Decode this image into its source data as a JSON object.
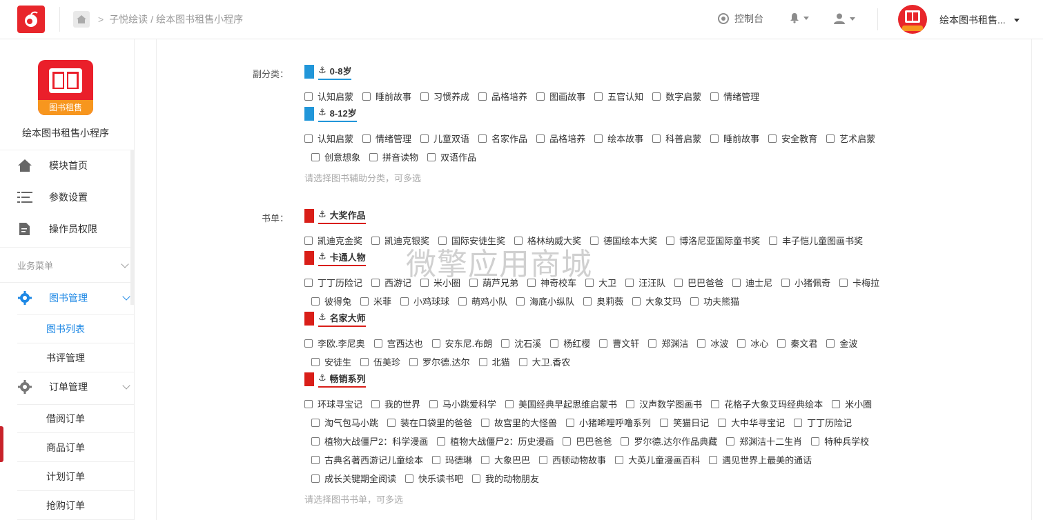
{
  "header": {
    "breadcrumb": [
      "子悦绘读",
      "绘本图书租售小程序"
    ],
    "breadcrumb_sep": ">",
    "console_label": "控制台",
    "store_name": "绘本图书租售...",
    "avatar_badge": "图书租售"
  },
  "sidebar": {
    "app_name": "绘本图书租售小程序",
    "logo_ribbon": "图书租售",
    "top_items": [
      {
        "label": "模块首页",
        "icon": "home-icon"
      },
      {
        "label": "参数设置",
        "icon": "list-settings-icon"
      },
      {
        "label": "操作员权限",
        "icon": "doc-edit-icon"
      }
    ],
    "group_title": "业务菜单",
    "book_mgmt": "图书管理",
    "book_sub": [
      "图书列表",
      "书评管理"
    ],
    "order_mgmt": "订单管理",
    "order_sub": [
      "借阅订单",
      "商品订单",
      "计划订单",
      "抢购订单"
    ]
  },
  "form": {
    "subcategory_label": "副分类：",
    "booklist_label": "书单：",
    "subcategory_hint": "请选择图书辅助分类，可多选",
    "booklist_hint": "请选择图书书单，可多选",
    "groups": {
      "age_0_8": {
        "title": "0-8岁",
        "options": [
          "认知启蒙",
          "睡前故事",
          "习惯养成",
          "品格培养",
          "图画故事",
          "五官认知",
          "数字启蒙",
          "情绪管理"
        ]
      },
      "age_8_12": {
        "title": "8-12岁",
        "options": [
          "认知启蒙",
          "情绪管理",
          "儿童双语",
          "名家作品",
          "品格培养",
          "绘本故事",
          "科普启蒙",
          "睡前故事",
          "安全教育",
          "艺术启蒙",
          "创意想象",
          "拼音读物",
          "双语作品"
        ]
      },
      "awards": {
        "title": "大奖作品",
        "options": [
          "凯迪克金奖",
          "凯迪克银奖",
          "国际安徒生奖",
          "格林纳威大奖",
          "德国绘本大奖",
          "博洛尼亚国际童书奖",
          "丰子恺儿童图画书奖"
        ]
      },
      "cartoon": {
        "title": "卡通人物",
        "options": [
          "丁丁历险记",
          "西游记",
          "米小圈",
          "葫芦兄弟",
          "神奇校车",
          "大卫",
          "汪汪队",
          "巴巴爸爸",
          "迪士尼",
          "小猪佩奇",
          "卡梅拉",
          "彼得兔",
          "米菲",
          "小鸡球球",
          "萌鸡小队",
          "海底小纵队",
          "奥莉薇",
          "大象艾玛",
          "功夫熊猫"
        ]
      },
      "masters": {
        "title": "名家大师",
        "options": [
          "李欧.李尼奥",
          "宫西达也",
          "安东尼.布朗",
          "沈石溪",
          "杨红樱",
          "曹文轩",
          "郑渊洁",
          "冰波",
          "冰心",
          "秦文君",
          "金波",
          "安徒生",
          "伍美珍",
          "罗尔德.达尔",
          "北猫",
          "大卫.香农"
        ]
      },
      "bestsellers": {
        "title": "畅销系列",
        "options": [
          "环球寻宝记",
          "我的世界",
          "马小跳爱科学",
          "美国经典早起思维启蒙书",
          "汉声数学图画书",
          "花格子大象艾玛经典绘本",
          "米小圈",
          "淘气包马小跳",
          "装在口袋里的爸爸",
          "故宫里的大怪兽",
          "小猪唏哩呼噜系列",
          "笑猫日记",
          "大中华寻宝记",
          "丁丁历险记",
          "植物大战僵尸2：科学漫画",
          "植物大战僵尸2：历史漫画",
          "巴巴爸爸",
          "罗尔德.达尔作品典藏",
          "郑渊洁十二生肖",
          "特种兵学校",
          "古典名著西游记儿童绘本",
          "玛德琳",
          "大象巴巴",
          "西顿动物故事",
          "大英儿童漫画百科",
          "遇见世界上最美的通话",
          "成长关键期全阅读",
          "快乐读书吧",
          "我的动物朋友"
        ]
      }
    }
  },
  "colors": {
    "brand_red": "#e8262b",
    "accent_blue": "#1e88e5",
    "flag_blue": "#2196d9",
    "flag_red": "#d91e18"
  },
  "watermark": "微擎应用商城"
}
